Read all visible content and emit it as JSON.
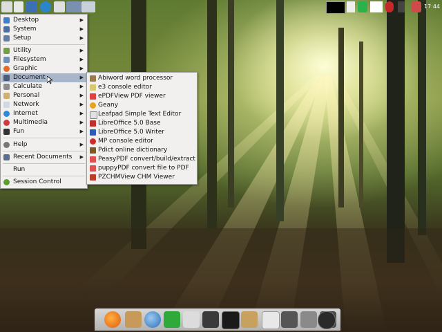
{
  "main_menu": {
    "items": [
      {
        "label": "Desktop",
        "icon": "desktop-icon",
        "submenu": true
      },
      {
        "label": "System",
        "icon": "system-icon",
        "submenu": true
      },
      {
        "label": "Setup",
        "icon": "setup-icon",
        "submenu": true
      },
      {
        "label": "Utility",
        "icon": "utility-icon",
        "submenu": true
      },
      {
        "label": "Filesystem",
        "icon": "filesystem-icon",
        "submenu": true
      },
      {
        "label": "Graphic",
        "icon": "graphic-icon",
        "submenu": true
      },
      {
        "label": "Document",
        "icon": "document-icon",
        "submenu": true,
        "highlighted": true
      },
      {
        "label": "Calculate",
        "icon": "calculate-icon",
        "submenu": true
      },
      {
        "label": "Personal",
        "icon": "personal-icon",
        "submenu": true
      },
      {
        "label": "Network",
        "icon": "network-icon",
        "submenu": true
      },
      {
        "label": "Internet",
        "icon": "internet-icon",
        "submenu": true
      },
      {
        "label": "Multimedia",
        "icon": "multimedia-icon",
        "submenu": true
      },
      {
        "label": "Fun",
        "icon": "fun-icon",
        "submenu": true
      },
      {
        "label": "Help",
        "icon": "help-icon",
        "submenu": true
      },
      {
        "label": "Recent Documents",
        "icon": "recent-documents-icon",
        "submenu": true
      },
      {
        "label": "Run",
        "icon": "",
        "submenu": false
      },
      {
        "label": "Session Control",
        "icon": "session-control-icon",
        "submenu": false
      }
    ]
  },
  "document_submenu": {
    "items": [
      {
        "label": "Abiword word processor",
        "icon": "abiword-icon"
      },
      {
        "label": "e3 console editor",
        "icon": "e3-editor-icon"
      },
      {
        "label": "ePDFView PDF viewer",
        "icon": "epdfview-icon"
      },
      {
        "label": "Geany",
        "icon": "geany-icon"
      },
      {
        "label": "Leafpad Simple Text Editor",
        "icon": "leafpad-icon"
      },
      {
        "label": "LibreOffice 5.0 Base",
        "icon": "libreoffice-base-icon"
      },
      {
        "label": "LibreOffice 5.0 Writer",
        "icon": "libreoffice-writer-icon"
      },
      {
        "label": "MP console editor",
        "icon": "mp-editor-icon"
      },
      {
        "label": "Pdict online dictionary",
        "icon": "pdict-icon"
      },
      {
        "label": "PeasyPDF convert/build/extract",
        "icon": "peasypdf-icon"
      },
      {
        "label": "puppyPDF convert file to PDF",
        "icon": "puppypdf-icon"
      },
      {
        "label": "PZCHMView CHM Viewer",
        "icon": "pzchmview-icon"
      }
    ]
  },
  "top_panel": {
    "clock": "17:44"
  },
  "colors": {
    "menu_bg": "#f1f0ee",
    "highlight": "#a9b6c9",
    "dock_bg": "#c4c4c4"
  }
}
